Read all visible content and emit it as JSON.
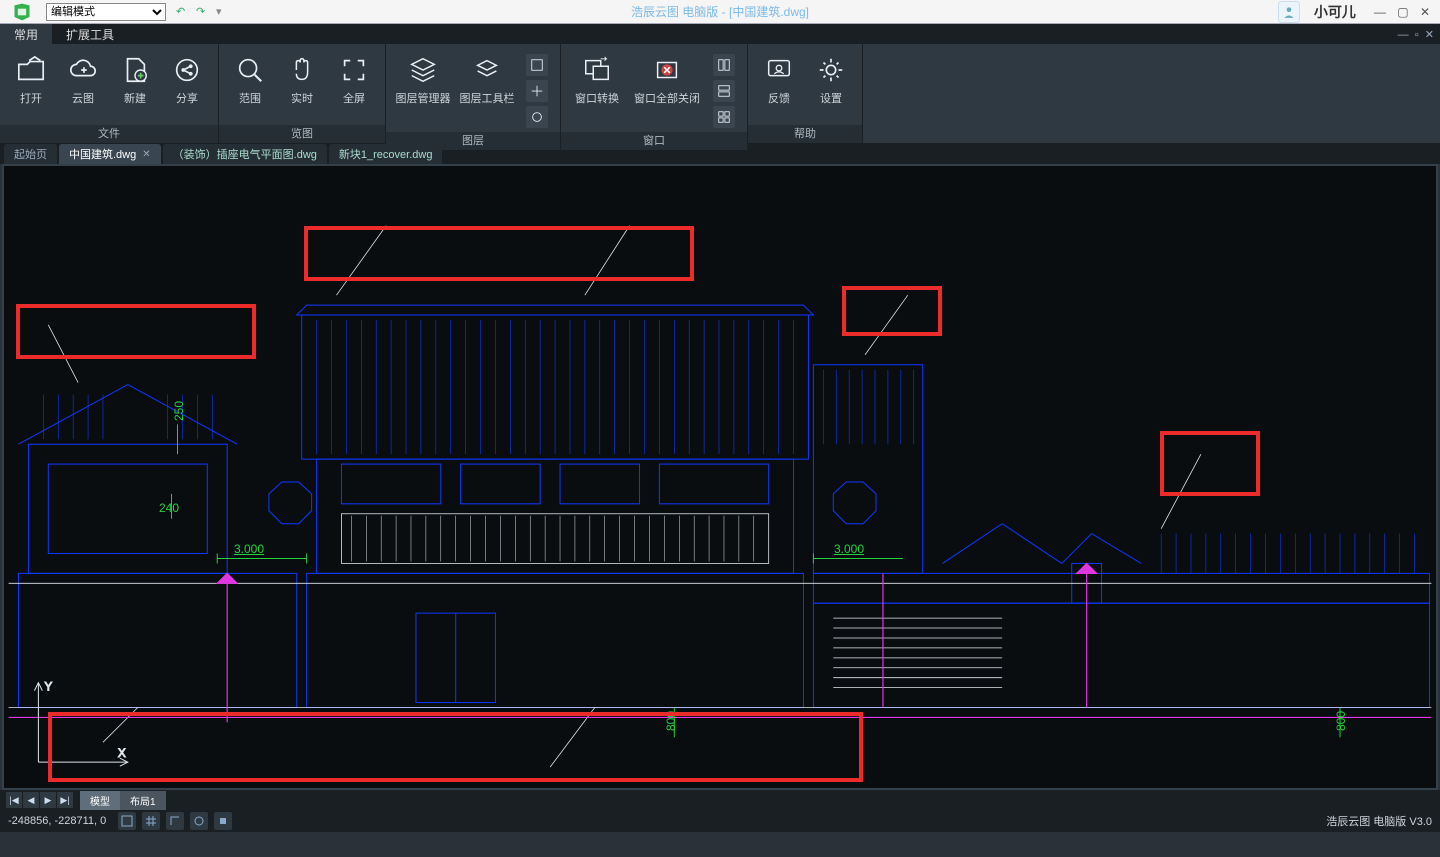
{
  "title": {
    "app": "浩辰云图 电脑版",
    "doc": "[中国建筑.dwg]"
  },
  "user": "小可儿",
  "mode_select": "编辑模式",
  "menu_tabs": {
    "a": "常用",
    "b": "扩展工具"
  },
  "ribbon": {
    "file": {
      "title": "文件",
      "open": "打开",
      "cloud": "云图",
      "new": "新建",
      "share": "分享"
    },
    "view": {
      "title": "览图",
      "extent": "范围",
      "realtime": "实时",
      "full": "全屏"
    },
    "layer": {
      "title": "图层",
      "mgr": "图层管理器",
      "toolbar": "图层工具栏"
    },
    "window": {
      "title": "窗口",
      "switch": "窗口转换",
      "closeall": "窗口全部关闭"
    },
    "help": {
      "title": "帮助",
      "feedback": "反馈",
      "settings": "设置"
    }
  },
  "doctabs": {
    "start": "起始页",
    "active": "中国建筑.dwg",
    "t2": "（装饰）插座电气平面图.dwg",
    "t3": "新块1_recover.dwg"
  },
  "dims": {
    "d250": "250",
    "d240": "240",
    "d3000a": "3.000",
    "d3000b": "3.000",
    "d800a": "800",
    "d800b": "800"
  },
  "bottom": {
    "model": "模型",
    "layout": "布局1"
  },
  "status": {
    "coords": "-248856, -228711, 0",
    "brand": "浩辰云图 电脑版 V3.0"
  }
}
